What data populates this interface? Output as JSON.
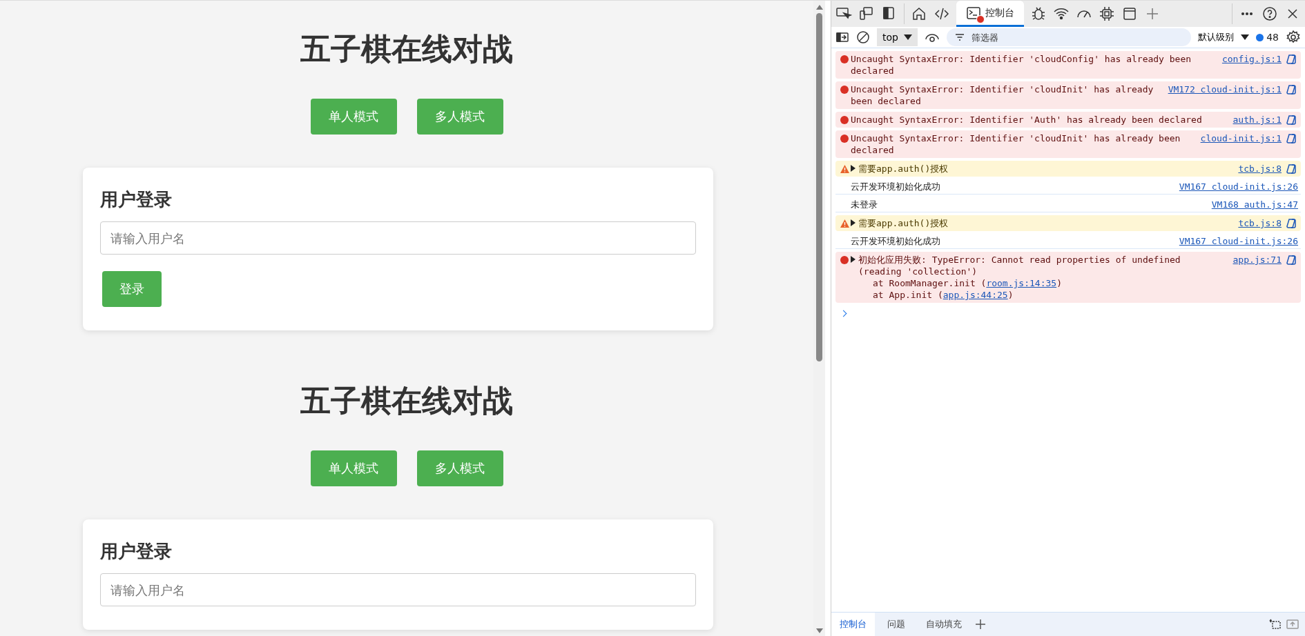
{
  "page": {
    "sections": [
      {
        "title": "五子棋在线对战",
        "mode_buttons": [
          "单人模式",
          "多人模式"
        ],
        "login": {
          "heading": "用户登录",
          "placeholder": "请输入用户名",
          "button": "登录"
        }
      },
      {
        "title": "五子棋在线对战",
        "mode_buttons": [
          "单人模式",
          "多人模式"
        ],
        "login": {
          "heading": "用户登录",
          "placeholder": "请输入用户名"
        }
      }
    ]
  },
  "devtools": {
    "tabs": [
      {
        "kind": "inspect"
      },
      {
        "kind": "device"
      },
      {
        "kind": "panel"
      },
      {
        "kind": "home"
      },
      {
        "kind": "code"
      },
      {
        "kind": "console",
        "label": "控制台",
        "selected": true,
        "error_badge": true
      },
      {
        "kind": "bug"
      },
      {
        "kind": "wifi"
      },
      {
        "kind": "gauge"
      },
      {
        "kind": "chip"
      },
      {
        "kind": "window"
      },
      {
        "kind": "plus"
      }
    ],
    "console_toolbar": {
      "context": "top",
      "filter_placeholder": "筛选器",
      "level": "默认级别",
      "message_count": "48"
    },
    "messages": [
      {
        "kind": "error",
        "expandable": false,
        "text": "Uncaught SyntaxError: Identifier 'cloudConfig' has already been declared",
        "source": "config.js:1",
        "explain": true
      },
      {
        "kind": "error",
        "expandable": false,
        "text": "Uncaught SyntaxError: Identifier 'cloudInit' has already been declared",
        "source": "VM172 cloud-init.js:1",
        "explain": true
      },
      {
        "kind": "error",
        "expandable": false,
        "text": "Uncaught SyntaxError: Identifier 'Auth' has already been declared",
        "source": "auth.js:1",
        "explain": true
      },
      {
        "kind": "error",
        "expandable": false,
        "text": "Uncaught SyntaxError: Identifier 'cloudInit' has already been declared",
        "source": "cloud-init.js:1",
        "explain": true
      },
      {
        "kind": "warning",
        "expandable": true,
        "text": "需要app.auth()授权",
        "source": "tcb.js:8",
        "explain": true
      },
      {
        "kind": "info",
        "expandable": false,
        "text": "云开发环境初始化成功",
        "source": "VM167 cloud-init.js:26",
        "explain": false
      },
      {
        "kind": "info",
        "expandable": false,
        "text": "未登录",
        "source": "VM168 auth.js:47",
        "explain": false
      },
      {
        "kind": "warning",
        "expandable": true,
        "text": "需要app.auth()授权",
        "source": "tcb.js:8",
        "explain": true
      },
      {
        "kind": "info",
        "expandable": false,
        "text": "云开发环境初始化成功",
        "source": "VM167 cloud-init.js:26",
        "explain": false
      },
      {
        "kind": "error",
        "expandable": true,
        "text": "初始化应用失败: TypeError: Cannot read properties of undefined (reading 'collection')",
        "source": "app.js:71",
        "explain": true,
        "stack": [
          {
            "prefix": "at RoomManager.init (",
            "link": "room.js:14:35",
            "suffix": ")"
          },
          {
            "prefix": "at App.init (",
            "link": "app.js:44:25",
            "suffix": ")"
          }
        ]
      }
    ],
    "drawer_tabs": [
      {
        "label": "控制台",
        "selected": true
      },
      {
        "label": "问题",
        "selected": false
      },
      {
        "label": "自动填充",
        "selected": false
      }
    ]
  }
}
